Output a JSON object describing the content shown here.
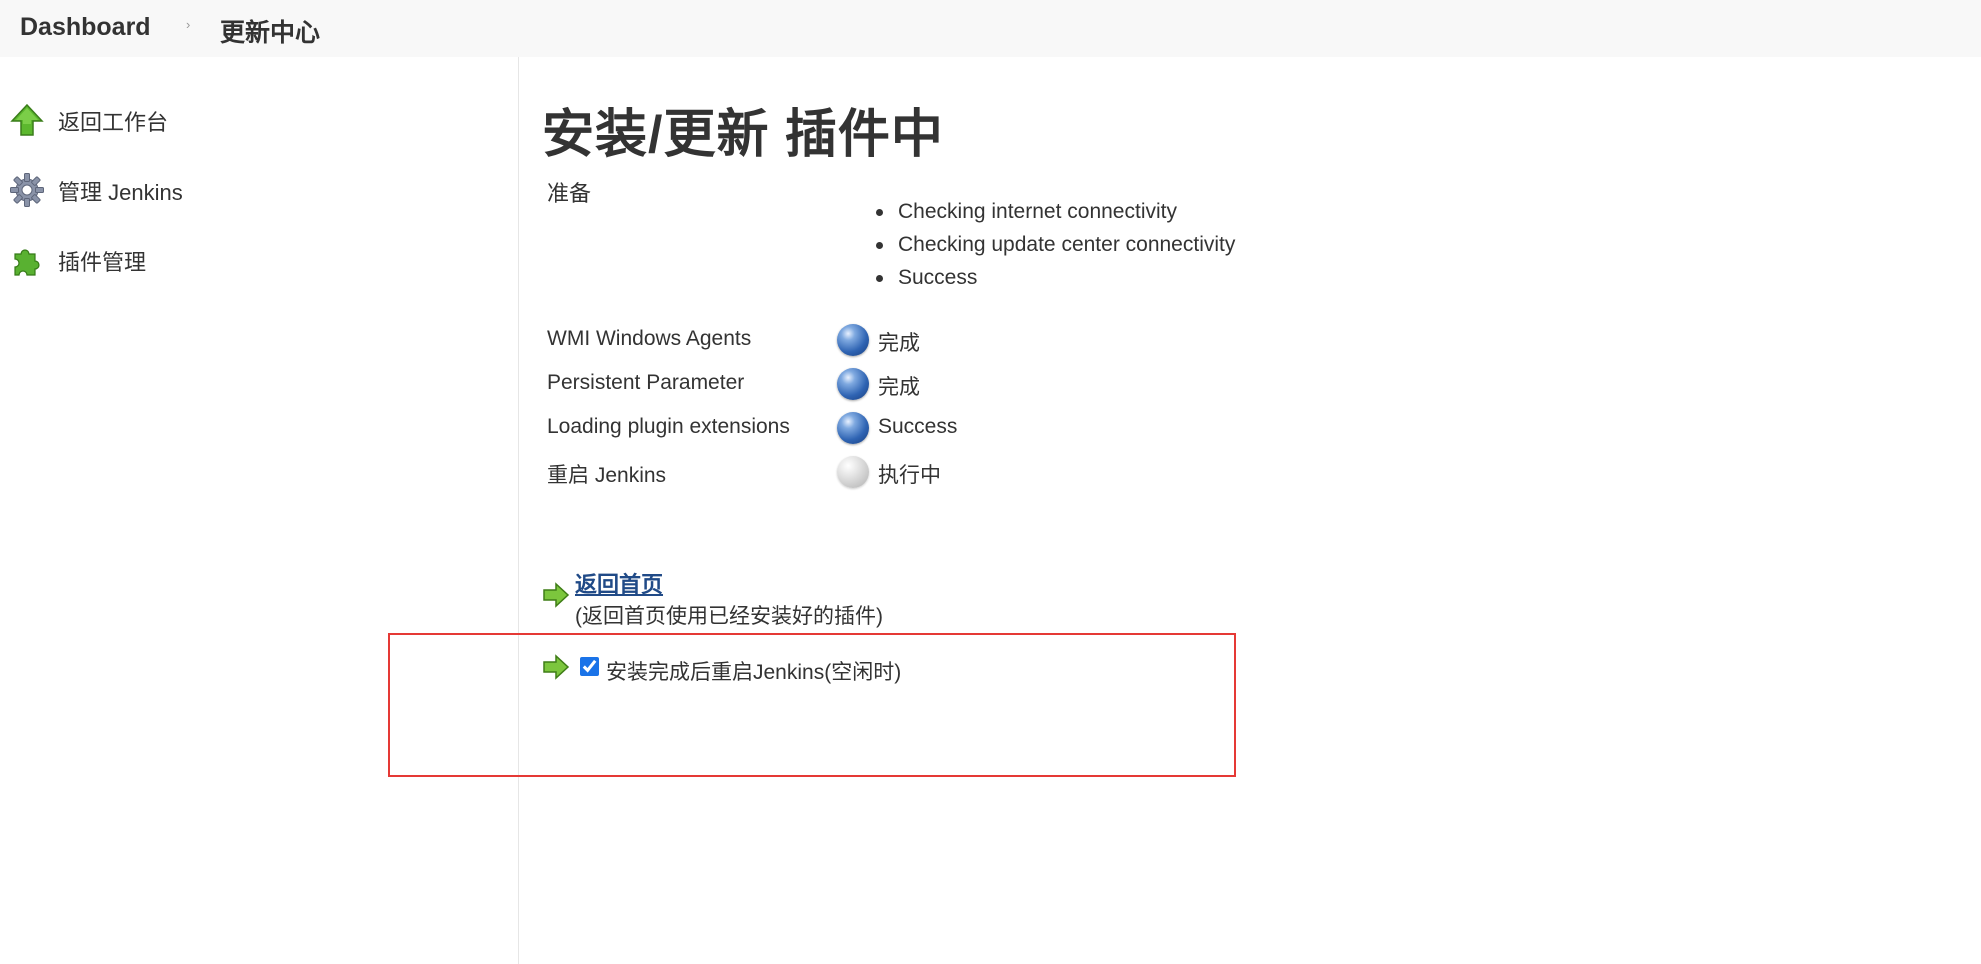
{
  "breadcrumb": {
    "items": [
      "Dashboard",
      "更新中心"
    ],
    "separator": "›"
  },
  "sidebar": {
    "items": [
      {
        "label": "返回工作台",
        "icon": "up-arrow-icon"
      },
      {
        "label": "管理 Jenkins",
        "icon": "gear-icon"
      },
      {
        "label": "插件管理",
        "icon": "puzzle-icon"
      }
    ]
  },
  "main": {
    "title": "安装/更新 插件中",
    "preparation": {
      "label": "准备",
      "steps": [
        "Checking internet connectivity",
        "Checking update center connectivity",
        "Success"
      ]
    },
    "plugins": [
      {
        "name": "WMI Windows Agents",
        "status": "完成",
        "indicator": "blue"
      },
      {
        "name": "Persistent Parameter",
        "status": "完成",
        "indicator": "blue"
      },
      {
        "name": "Loading plugin extensions",
        "status": "Success",
        "indicator": "blue"
      },
      {
        "name": "重启 Jenkins",
        "status": "执行中",
        "indicator": "grey"
      }
    ],
    "home_link": {
      "label": "返回首页",
      "description": "(返回首页使用已经安装好的插件)"
    },
    "restart_option": {
      "label": "安装完成后重启Jenkins(空闲时)",
      "checked": true
    }
  },
  "colors": {
    "link": "#204a87",
    "highlight_border": "#e53935",
    "status_blue": "#2f64b3",
    "status_grey": "#c4c4c4",
    "arrow_green": "#6fbf3a"
  }
}
